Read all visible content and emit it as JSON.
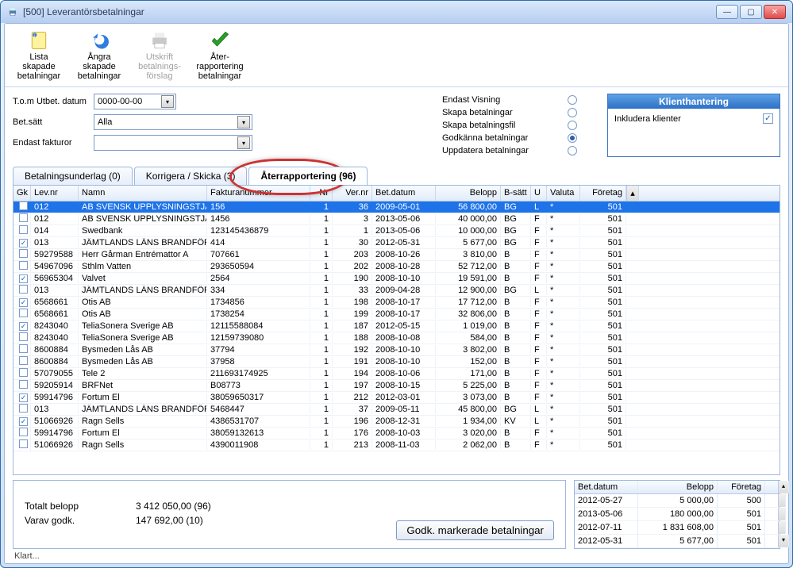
{
  "window": {
    "title": "[500] Leverantörsbetalningar"
  },
  "toolbar": {
    "list": "Lista\nskapade\nbetalningar",
    "undo": "Ångra\nskapade\nbetalningar",
    "print": "Utskrift\nbetalnings-\nförslag",
    "report": "Åter-\nrapportering\nbetalningar"
  },
  "filters": {
    "date_label": "T.o.m Utbet. datum",
    "date_value": "0000-00-00",
    "betsatt_label": "Bet.sätt",
    "betsatt_value": "Alla",
    "endast_label": "Endast fakturor",
    "endast_value": ""
  },
  "radios": {
    "r1": "Endast Visning",
    "r2": "Skapa betalningar",
    "r3": "Skapa betalningsfil",
    "r4": "Godkänna betalningar",
    "r5": "Uppdatera betalningar",
    "selected": "r4"
  },
  "panel": {
    "title": "Klienthantering",
    "chk_label": "Inkludera klienter",
    "chk_checked": true
  },
  "tabs": {
    "t1": "Betalningsunderlag (0)",
    "t2": "Korrigera / Skicka (3)",
    "t3": "Återrapportering (96)"
  },
  "columns": {
    "gk": "Gk",
    "lev": "Lev.nr",
    "namn": "Namn",
    "faktnr": "Fakturanummer",
    "nr": "Nr",
    "ver": "Ver.nr",
    "betdat": "Bet.datum",
    "belopp": "Belopp",
    "bsatt": "B-sätt",
    "u": "U",
    "valuta": "Valuta",
    "foretag": "Företag"
  },
  "rows": [
    {
      "gk": false,
      "sel": true,
      "lev": "012",
      "namn": "AB SVENSK UPPLYSNINGSTJÄ",
      "fakt": "156",
      "nr": "1",
      "ver": "36",
      "dat": "2009-05-01",
      "bel": "56 800,00",
      "bs": "BG",
      "u": "L",
      "val": "*",
      "f": "501"
    },
    {
      "gk": false,
      "lev": "012",
      "namn": "AB SVENSK UPPLYSNINGSTJÄ",
      "fakt": "1456",
      "nr": "1",
      "ver": "3",
      "dat": "2013-05-06",
      "bel": "40 000,00",
      "bs": "BG",
      "u": "F",
      "val": "*",
      "f": "501"
    },
    {
      "gk": false,
      "lev": "014",
      "namn": "Swedbank",
      "fakt": "123145436879",
      "nr": "1",
      "ver": "1",
      "dat": "2013-05-06",
      "bel": "10 000,00",
      "bs": "BG",
      "u": "F",
      "val": "*",
      "f": "501"
    },
    {
      "gk": true,
      "lev": "013",
      "namn": "JÄMTLANDS LÄNS BRANDFÖR",
      "fakt": "414",
      "nr": "1",
      "ver": "30",
      "dat": "2012-05-31",
      "bel": "5 677,00",
      "bs": "BG",
      "u": "F",
      "val": "*",
      "f": "501"
    },
    {
      "gk": false,
      "lev": "59279588",
      "namn": "Herr Gårman Entrémattor A",
      "fakt": "707661",
      "nr": "1",
      "ver": "203",
      "dat": "2008-10-26",
      "bel": "3 810,00",
      "bs": "B",
      "u": "F",
      "val": "*",
      "f": "501"
    },
    {
      "gk": false,
      "lev": "54967096",
      "namn": "Sthlm Vatten",
      "fakt": "293650594",
      "nr": "1",
      "ver": "202",
      "dat": "2008-10-28",
      "bel": "52 712,00",
      "bs": "B",
      "u": "F",
      "val": "*",
      "f": "501"
    },
    {
      "gk": true,
      "lev": "56965304",
      "namn": "Valvet",
      "fakt": "2564",
      "nr": "1",
      "ver": "190",
      "dat": "2008-10-10",
      "bel": "19 591,00",
      "bs": "B",
      "u": "F",
      "val": "*",
      "f": "501"
    },
    {
      "gk": false,
      "lev": "013",
      "namn": "JÄMTLANDS LÄNS BRANDFÖR",
      "fakt": "334",
      "nr": "1",
      "ver": "33",
      "dat": "2009-04-28",
      "bel": "12 900,00",
      "bs": "BG",
      "u": "L",
      "val": "*",
      "f": "501"
    },
    {
      "gk": true,
      "lev": "6568661",
      "namn": "Otis AB",
      "fakt": "1734856",
      "nr": "1",
      "ver": "198",
      "dat": "2008-10-17",
      "bel": "17 712,00",
      "bs": "B",
      "u": "F",
      "val": "*",
      "f": "501"
    },
    {
      "gk": false,
      "lev": "6568661",
      "namn": "Otis AB",
      "fakt": "1738254",
      "nr": "1",
      "ver": "199",
      "dat": "2008-10-17",
      "bel": "32 806,00",
      "bs": "B",
      "u": "F",
      "val": "*",
      "f": "501"
    },
    {
      "gk": true,
      "lev": "8243040",
      "namn": "TeliaSonera Sverige AB",
      "fakt": "12115588084",
      "nr": "1",
      "ver": "187",
      "dat": "2012-05-15",
      "bel": "1 019,00",
      "bs": "B",
      "u": "F",
      "val": "*",
      "f": "501"
    },
    {
      "gk": false,
      "lev": "8243040",
      "namn": "TeliaSonera Sverige AB",
      "fakt": "12159739080",
      "nr": "1",
      "ver": "188",
      "dat": "2008-10-08",
      "bel": "584,00",
      "bs": "B",
      "u": "F",
      "val": "*",
      "f": "501"
    },
    {
      "gk": false,
      "lev": "8600884",
      "namn": "Bysmeden Lås AB",
      "fakt": "37794",
      "nr": "1",
      "ver": "192",
      "dat": "2008-10-10",
      "bel": "3 802,00",
      "bs": "B",
      "u": "F",
      "val": "*",
      "f": "501"
    },
    {
      "gk": false,
      "lev": "8600884",
      "namn": "Bysmeden Lås AB",
      "fakt": "37958",
      "nr": "1",
      "ver": "191",
      "dat": "2008-10-10",
      "bel": "152,00",
      "bs": "B",
      "u": "F",
      "val": "*",
      "f": "501"
    },
    {
      "gk": false,
      "lev": "57079055",
      "namn": "Tele 2",
      "fakt": "211693174925",
      "nr": "1",
      "ver": "194",
      "dat": "2008-10-06",
      "bel": "171,00",
      "bs": "B",
      "u": "F",
      "val": "*",
      "f": "501"
    },
    {
      "gk": false,
      "lev": "59205914",
      "namn": "BRFNet",
      "fakt": "B08773",
      "nr": "1",
      "ver": "197",
      "dat": "2008-10-15",
      "bel": "5 225,00",
      "bs": "B",
      "u": "F",
      "val": "*",
      "f": "501"
    },
    {
      "gk": true,
      "lev": "59914796",
      "namn": "Fortum El",
      "fakt": "38059650317",
      "nr": "1",
      "ver": "212",
      "dat": "2012-03-01",
      "bel": "3 073,00",
      "bs": "B",
      "u": "F",
      "val": "*",
      "f": "501"
    },
    {
      "gk": false,
      "lev": "013",
      "namn": "JÄMTLANDS LÄNS BRANDFÖR",
      "fakt": "5468447",
      "nr": "1",
      "ver": "37",
      "dat": "2009-05-11",
      "bel": "45 800,00",
      "bs": "BG",
      "u": "L",
      "val": "*",
      "f": "501"
    },
    {
      "gk": true,
      "lev": "51066926",
      "namn": "Ragn Sells",
      "fakt": "4386531707",
      "nr": "1",
      "ver": "196",
      "dat": "2008-12-31",
      "bel": "1 934,00",
      "bs": "KV",
      "u": "L",
      "val": "*",
      "f": "501"
    },
    {
      "gk": false,
      "lev": "59914796",
      "namn": "Fortum El",
      "fakt": "38059132613",
      "nr": "1",
      "ver": "176",
      "dat": "2008-10-03",
      "bel": "3 020,00",
      "bs": "B",
      "u": "F",
      "val": "*",
      "f": "501"
    },
    {
      "gk": false,
      "lev": "51066926",
      "namn": "Ragn Sells",
      "fakt": "4390011908",
      "nr": "1",
      "ver": "213",
      "dat": "2008-11-03",
      "bel": "2 062,00",
      "bs": "B",
      "u": "F",
      "val": "*",
      "f": "501"
    }
  ],
  "summary": {
    "total_label": "Totalt belopp",
    "total_value": "3 412 050,00  (96)",
    "godk_label": "Varav godk.",
    "godk_value": "147 692,00  (10)",
    "button": "Godk. markerade betalningar"
  },
  "mini": {
    "cols": {
      "dat": "Bet.datum",
      "bel": "Belopp",
      "f": "Företag"
    },
    "rows": [
      {
        "dat": "2012-05-27",
        "bel": "5 000,00",
        "f": "500"
      },
      {
        "dat": "2013-05-06",
        "bel": "180 000,00",
        "f": "501"
      },
      {
        "dat": "2012-07-11",
        "bel": "1 831 608,00",
        "f": "501"
      },
      {
        "dat": "2012-05-31",
        "bel": "5 677,00",
        "f": "501"
      }
    ]
  },
  "status": "Klart..."
}
